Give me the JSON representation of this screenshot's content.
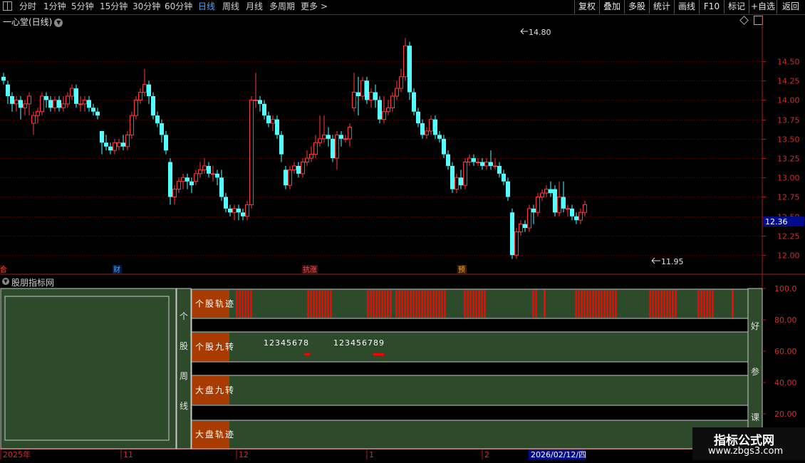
{
  "toolbar": {
    "periods": [
      "分时",
      "1分钟",
      "5分钟",
      "15分钟",
      "30分钟",
      "60分钟",
      "日线",
      "周线",
      "月线",
      "多周期",
      "更多 >"
    ],
    "active_period": "日线",
    "right_buttons": [
      "复权",
      "叠加",
      "多股",
      "统计",
      "画线",
      "F10",
      "标记",
      "+自选",
      "返回"
    ]
  },
  "chart_title": "一心堂(日线)",
  "colors": {
    "up": "#ff3c3c",
    "down": "#54ffff",
    "grid": "#7a0000",
    "axis_text": "#cc3030",
    "panel_green": "#2d4a2a",
    "panel_red": "#ff0000",
    "label_brown": "#a83c00",
    "current_price_bg": "#000c8c"
  },
  "chart_data": [
    {
      "type": "candlestick",
      "title": "一心堂(日线)",
      "ylim": [
        11.9,
        14.95
      ],
      "yticks": [
        12.0,
        12.25,
        12.5,
        12.75,
        13.0,
        13.25,
        13.5,
        13.75,
        14.0,
        14.25,
        14.5
      ],
      "ytick_labels": [
        "12.00",
        "12.25",
        "12.50",
        "12.75",
        "13.00",
        "13.25",
        "13.50",
        "13.75",
        "14.00",
        "14.25",
        "14.50"
      ],
      "high_marker": "14.80",
      "low_marker": "11.95",
      "current_price": "12.36",
      "event_tags": [
        "财",
        "抗涨",
        "预"
      ],
      "candles": [
        [
          14.3,
          14.25,
          14.35,
          14.2
        ],
        [
          14.2,
          14.05,
          14.25,
          13.95
        ],
        [
          14.05,
          13.95,
          14.1,
          13.85
        ],
        [
          13.95,
          14.0,
          14.05,
          13.85
        ],
        [
          14.0,
          13.9,
          14.05,
          13.75
        ],
        [
          13.9,
          13.95,
          14.0,
          13.8
        ],
        [
          13.95,
          14.05,
          14.1,
          13.8
        ],
        [
          13.7,
          13.8,
          13.85,
          13.55
        ],
        [
          13.8,
          13.85,
          13.9,
          13.7
        ],
        [
          13.85,
          14.05,
          14.1,
          13.8
        ],
        [
          14.05,
          14.0,
          14.1,
          13.9
        ],
        [
          14.0,
          13.9,
          14.05,
          13.85
        ],
        [
          13.9,
          14.0,
          14.05,
          13.85
        ],
        [
          14.0,
          13.9,
          14.05,
          13.85
        ],
        [
          13.9,
          13.95,
          14.05,
          13.85
        ],
        [
          13.95,
          14.05,
          14.1,
          13.9
        ],
        [
          14.05,
          14.15,
          14.2,
          14.0
        ],
        [
          14.15,
          13.95,
          14.2,
          13.9
        ],
        [
          13.95,
          13.95,
          14.05,
          13.85
        ],
        [
          13.95,
          14.0,
          14.05,
          13.85
        ],
        [
          14.0,
          13.9,
          14.05,
          13.85
        ],
        [
          13.9,
          13.85,
          13.95,
          13.8
        ],
        [
          13.85,
          13.8,
          13.9,
          13.75
        ],
        [
          13.6,
          13.45,
          13.6,
          13.3
        ],
        [
          13.45,
          13.4,
          13.55,
          13.35
        ],
        [
          13.4,
          13.35,
          13.45,
          13.3
        ],
        [
          13.35,
          13.45,
          13.5,
          13.3
        ],
        [
          13.4,
          13.45,
          13.5,
          13.35
        ],
        [
          13.45,
          13.4,
          13.55,
          13.35
        ],
        [
          13.4,
          13.55,
          13.6,
          13.35
        ],
        [
          13.55,
          13.8,
          13.85,
          13.5
        ],
        [
          13.8,
          14.0,
          14.05,
          13.75
        ],
        [
          14.0,
          14.1,
          14.15,
          13.95
        ],
        [
          14.1,
          14.2,
          14.4,
          14.05
        ],
        [
          14.2,
          14.05,
          14.25,
          13.95
        ],
        [
          14.05,
          13.8,
          14.1,
          13.75
        ],
        [
          13.8,
          13.7,
          13.85,
          13.65
        ],
        [
          13.7,
          13.55,
          13.75,
          13.45
        ],
        [
          13.55,
          13.35,
          13.6,
          13.3
        ],
        [
          13.2,
          12.75,
          13.25,
          12.65
        ],
        [
          12.75,
          12.85,
          12.9,
          12.65
        ],
        [
          12.85,
          12.95,
          13.0,
          12.8
        ],
        [
          12.95,
          13.0,
          13.05,
          12.85
        ],
        [
          13.0,
          12.95,
          13.05,
          12.85
        ],
        [
          12.95,
          12.9,
          13.0,
          12.8
        ],
        [
          12.95,
          13.05,
          13.1,
          12.9
        ],
        [
          13.05,
          13.1,
          13.2,
          13.0
        ],
        [
          13.1,
          13.15,
          13.25,
          13.05
        ],
        [
          13.15,
          13.05,
          13.2,
          13.0
        ],
        [
          13.05,
          13.05,
          13.15,
          12.95
        ],
        [
          13.05,
          13.0,
          13.1,
          12.9
        ],
        [
          13.0,
          12.75,
          13.1,
          12.7
        ],
        [
          12.75,
          12.6,
          12.8,
          12.55
        ],
        [
          12.6,
          12.55,
          12.65,
          12.5
        ],
        [
          12.55,
          12.6,
          12.65,
          12.45
        ],
        [
          12.6,
          12.55,
          12.65,
          12.45
        ],
        [
          12.55,
          12.5,
          12.6,
          12.45
        ],
        [
          12.5,
          12.65,
          12.7,
          12.45
        ],
        [
          12.65,
          14.0,
          14.05,
          12.6
        ],
        [
          14.0,
          14.0,
          14.35,
          13.9
        ],
        [
          14.0,
          13.95,
          14.05,
          13.85
        ],
        [
          13.95,
          13.8,
          14.0,
          13.75
        ],
        [
          13.8,
          13.7,
          13.85,
          13.65
        ],
        [
          13.7,
          13.75,
          13.8,
          13.6
        ],
        [
          13.75,
          13.55,
          13.8,
          13.5
        ],
        [
          13.55,
          13.3,
          13.6,
          13.2
        ],
        [
          13.1,
          12.9,
          13.15,
          12.85
        ],
        [
          12.9,
          13.1,
          13.15,
          12.85
        ],
        [
          13.1,
          13.15,
          13.2,
          13.05
        ],
        [
          13.15,
          13.05,
          13.2,
          13.0
        ],
        [
          13.05,
          13.2,
          13.25,
          13.0
        ],
        [
          13.2,
          13.25,
          13.35,
          13.15
        ],
        [
          13.25,
          13.3,
          13.4,
          13.2
        ],
        [
          13.3,
          13.45,
          13.55,
          13.25
        ],
        [
          13.45,
          13.5,
          13.8,
          13.4
        ],
        [
          13.5,
          13.55,
          13.8,
          13.45
        ],
        [
          13.55,
          13.5,
          13.65,
          13.4
        ],
        [
          13.5,
          13.25,
          13.55,
          13.2
        ],
        [
          13.25,
          13.55,
          13.6,
          13.1
        ],
        [
          13.55,
          13.5,
          13.6,
          13.4
        ],
        [
          13.5,
          13.5,
          13.55,
          13.45
        ],
        [
          13.5,
          13.65,
          13.7,
          13.4
        ],
        [
          13.9,
          14.1,
          14.35,
          13.85
        ],
        [
          14.1,
          14.05,
          14.3,
          13.8
        ],
        [
          14.05,
          14.25,
          14.3,
          14.0
        ],
        [
          14.25,
          14.0,
          14.3,
          13.95
        ],
        [
          14.0,
          14.1,
          14.15,
          13.9
        ],
        [
          14.1,
          14.0,
          14.2,
          13.9
        ],
        [
          14.0,
          13.75,
          14.05,
          13.7
        ],
        [
          13.75,
          13.85,
          14.05,
          13.7
        ],
        [
          13.85,
          13.9,
          14.0,
          13.8
        ],
        [
          13.9,
          14.05,
          14.1,
          13.85
        ],
        [
          14.05,
          14.15,
          14.25,
          14.0
        ],
        [
          14.15,
          14.3,
          14.4,
          14.1
        ],
        [
          14.3,
          14.7,
          14.8,
          14.25
        ],
        [
          14.7,
          14.1,
          14.75,
          14.0
        ],
        [
          14.1,
          13.85,
          14.15,
          13.8
        ],
        [
          13.85,
          13.7,
          13.9,
          13.65
        ],
        [
          13.7,
          13.55,
          13.75,
          13.5
        ],
        [
          13.55,
          13.6,
          13.65,
          13.5
        ],
        [
          13.6,
          13.75,
          13.8,
          13.55
        ],
        [
          13.75,
          13.55,
          13.8,
          13.5
        ],
        [
          13.55,
          13.5,
          13.6,
          13.45
        ],
        [
          13.5,
          13.3,
          13.55,
          13.25
        ],
        [
          13.3,
          13.15,
          13.35,
          13.1
        ],
        [
          13.15,
          12.85,
          13.2,
          12.8
        ],
        [
          12.85,
          13.0,
          13.05,
          12.8
        ],
        [
          13.0,
          12.9,
          13.1,
          12.85
        ],
        [
          12.9,
          13.2,
          13.25,
          12.85
        ],
        [
          13.2,
          13.25,
          13.3,
          13.15
        ],
        [
          13.25,
          13.2,
          13.3,
          13.15
        ],
        [
          13.2,
          13.2,
          13.25,
          13.15
        ],
        [
          13.2,
          13.15,
          13.25,
          13.1
        ],
        [
          13.15,
          13.2,
          13.25,
          13.1
        ],
        [
          13.2,
          13.15,
          13.35,
          13.1
        ],
        [
          13.15,
          13.15,
          13.25,
          13.1
        ],
        [
          13.15,
          13.05,
          13.2,
          13.0
        ],
        [
          13.05,
          12.95,
          13.1,
          12.9
        ],
        [
          12.95,
          12.75,
          13.0,
          12.7
        ],
        [
          12.55,
          12.0,
          12.6,
          11.95
        ],
        [
          12.0,
          12.3,
          12.35,
          11.95
        ],
        [
          12.3,
          12.4,
          12.45,
          12.25
        ],
        [
          12.4,
          12.35,
          12.45,
          12.3
        ],
        [
          12.35,
          12.6,
          12.65,
          12.3
        ],
        [
          12.6,
          12.55,
          12.65,
          12.4
        ],
        [
          12.55,
          12.75,
          12.8,
          12.5
        ],
        [
          12.75,
          12.8,
          12.85,
          12.7
        ],
        [
          12.8,
          12.85,
          12.9,
          12.75
        ],
        [
          12.85,
          12.8,
          12.95,
          12.75
        ],
        [
          12.85,
          12.55,
          12.9,
          12.5
        ],
        [
          12.55,
          12.75,
          12.95,
          12.5
        ],
        [
          12.75,
          12.6,
          12.95,
          12.55
        ],
        [
          12.6,
          12.6,
          12.65,
          12.5
        ],
        [
          12.6,
          12.5,
          12.65,
          12.45
        ],
        [
          12.5,
          12.45,
          12.55,
          12.4
        ],
        [
          12.45,
          12.55,
          12.6,
          12.4
        ],
        [
          12.55,
          12.65,
          12.7,
          12.5
        ]
      ]
    },
    {
      "type": "heatmap",
      "title": "股朋指标网",
      "ylim": [
        0,
        100
      ],
      "yticks": [
        20,
        40,
        60,
        80,
        100
      ],
      "ytick_labels": [
        "20.00",
        "40.00",
        "60.00",
        "80.00",
        "100.0"
      ],
      "group_label": "个股周线",
      "right_label": "好参课",
      "rows": [
        {
          "name": "个股轨迹",
          "active_ranges": [
            [
              0,
              6
            ],
            [
              25,
              34
            ],
            [
              46,
              55
            ],
            [
              56,
              74
            ],
            [
              80,
              88
            ],
            [
              104,
              106
            ],
            [
              108,
              109
            ],
            [
              119,
              134
            ],
            [
              145,
              155
            ],
            [
              162,
              168
            ],
            [
              174,
              175
            ]
          ]
        },
        {
          "name": "个股九转",
          "sequences": [
            "12345678",
            "123456789"
          ]
        },
        {
          "name": "大盘九转"
        },
        {
          "name": "大盘轨迹"
        }
      ]
    }
  ],
  "time_axis": [
    "2025年",
    "11",
    "12",
    "1",
    "2"
  ],
  "cursor_date": "2026/02/12/四",
  "watermark": {
    "title": "指标公式网",
    "url": "www.zbgs3.com"
  }
}
